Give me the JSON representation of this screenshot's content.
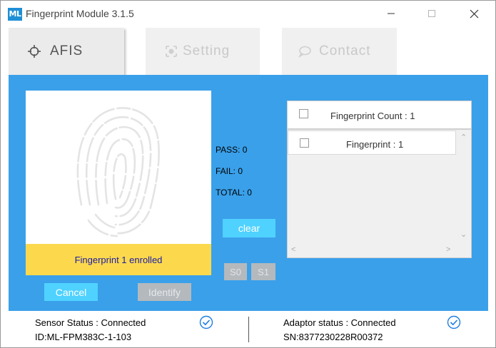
{
  "window": {
    "app_icon": "ML",
    "title": "Fingerprint Module 3.1.5",
    "controls": [
      "minimize-icon",
      "maximize-icon",
      "close-icon"
    ]
  },
  "tabs": [
    {
      "label": "AFIS",
      "icon": "crosshair-icon",
      "active": true
    },
    {
      "label": "Setting",
      "icon": "settings-icon",
      "active": false
    },
    {
      "label": "Contact",
      "icon": "chat-bubble-icon",
      "active": false
    }
  ],
  "main": {
    "fingerprint_status": "Fingerprint 1 enrolled",
    "stats": {
      "pass": "PASS: 0",
      "fail": "FAIL:  0",
      "total": "TOTAL: 0"
    },
    "buttons": {
      "clear": "clear",
      "s0": "S0",
      "s1": "S1",
      "cancel": "Cancel",
      "identify": "Identify"
    },
    "list": {
      "header": "Fingerprint Count : 1",
      "items": [
        {
          "label": "Fingerprint : 1"
        }
      ]
    }
  },
  "status": {
    "sensor_status": "Sensor Status : Connected",
    "sensor_id": "ID:ML-FPM383C-1-103",
    "adaptor_status": "Adaptor status : Connected",
    "adaptor_sn": "SN:8377230228R00372"
  },
  "colors": {
    "panel": "#3aa0ea",
    "accent_button": "#4fd2ff",
    "disabled_button": "#b4b9bd",
    "status_bar": "#fcd94c",
    "status_text": "#1a1aa8",
    "check": "#1e7fe0"
  }
}
